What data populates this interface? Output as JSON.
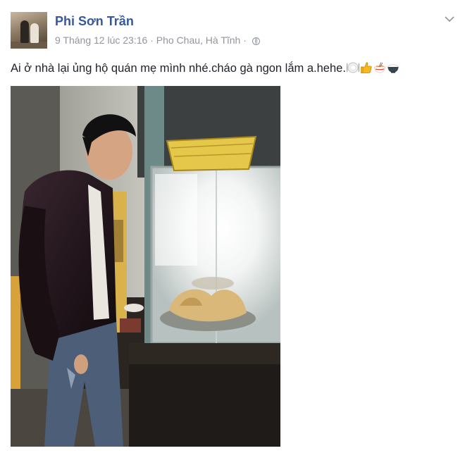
{
  "post": {
    "author": "Phi Sơn Trần",
    "timestamp": "9 Tháng 12 lúc 23:16",
    "separator": "·",
    "location": "Pho Chau, Hà Tĩnh",
    "separator2": "·",
    "text": "Ai ở nhà lại ủng hộ quán mẹ mình nhé.cháo gà ngon lắm a.hehe.",
    "emojis": [
      "plate-icon",
      "thumbs-up-icon",
      "noodle-bowl-icon",
      "rice-bowl-icon"
    ],
    "photo_icon": "photo-food-stall"
  },
  "colors": {
    "author_link": "#365899",
    "meta_text": "#90949c",
    "body_text": "#1d2129"
  }
}
